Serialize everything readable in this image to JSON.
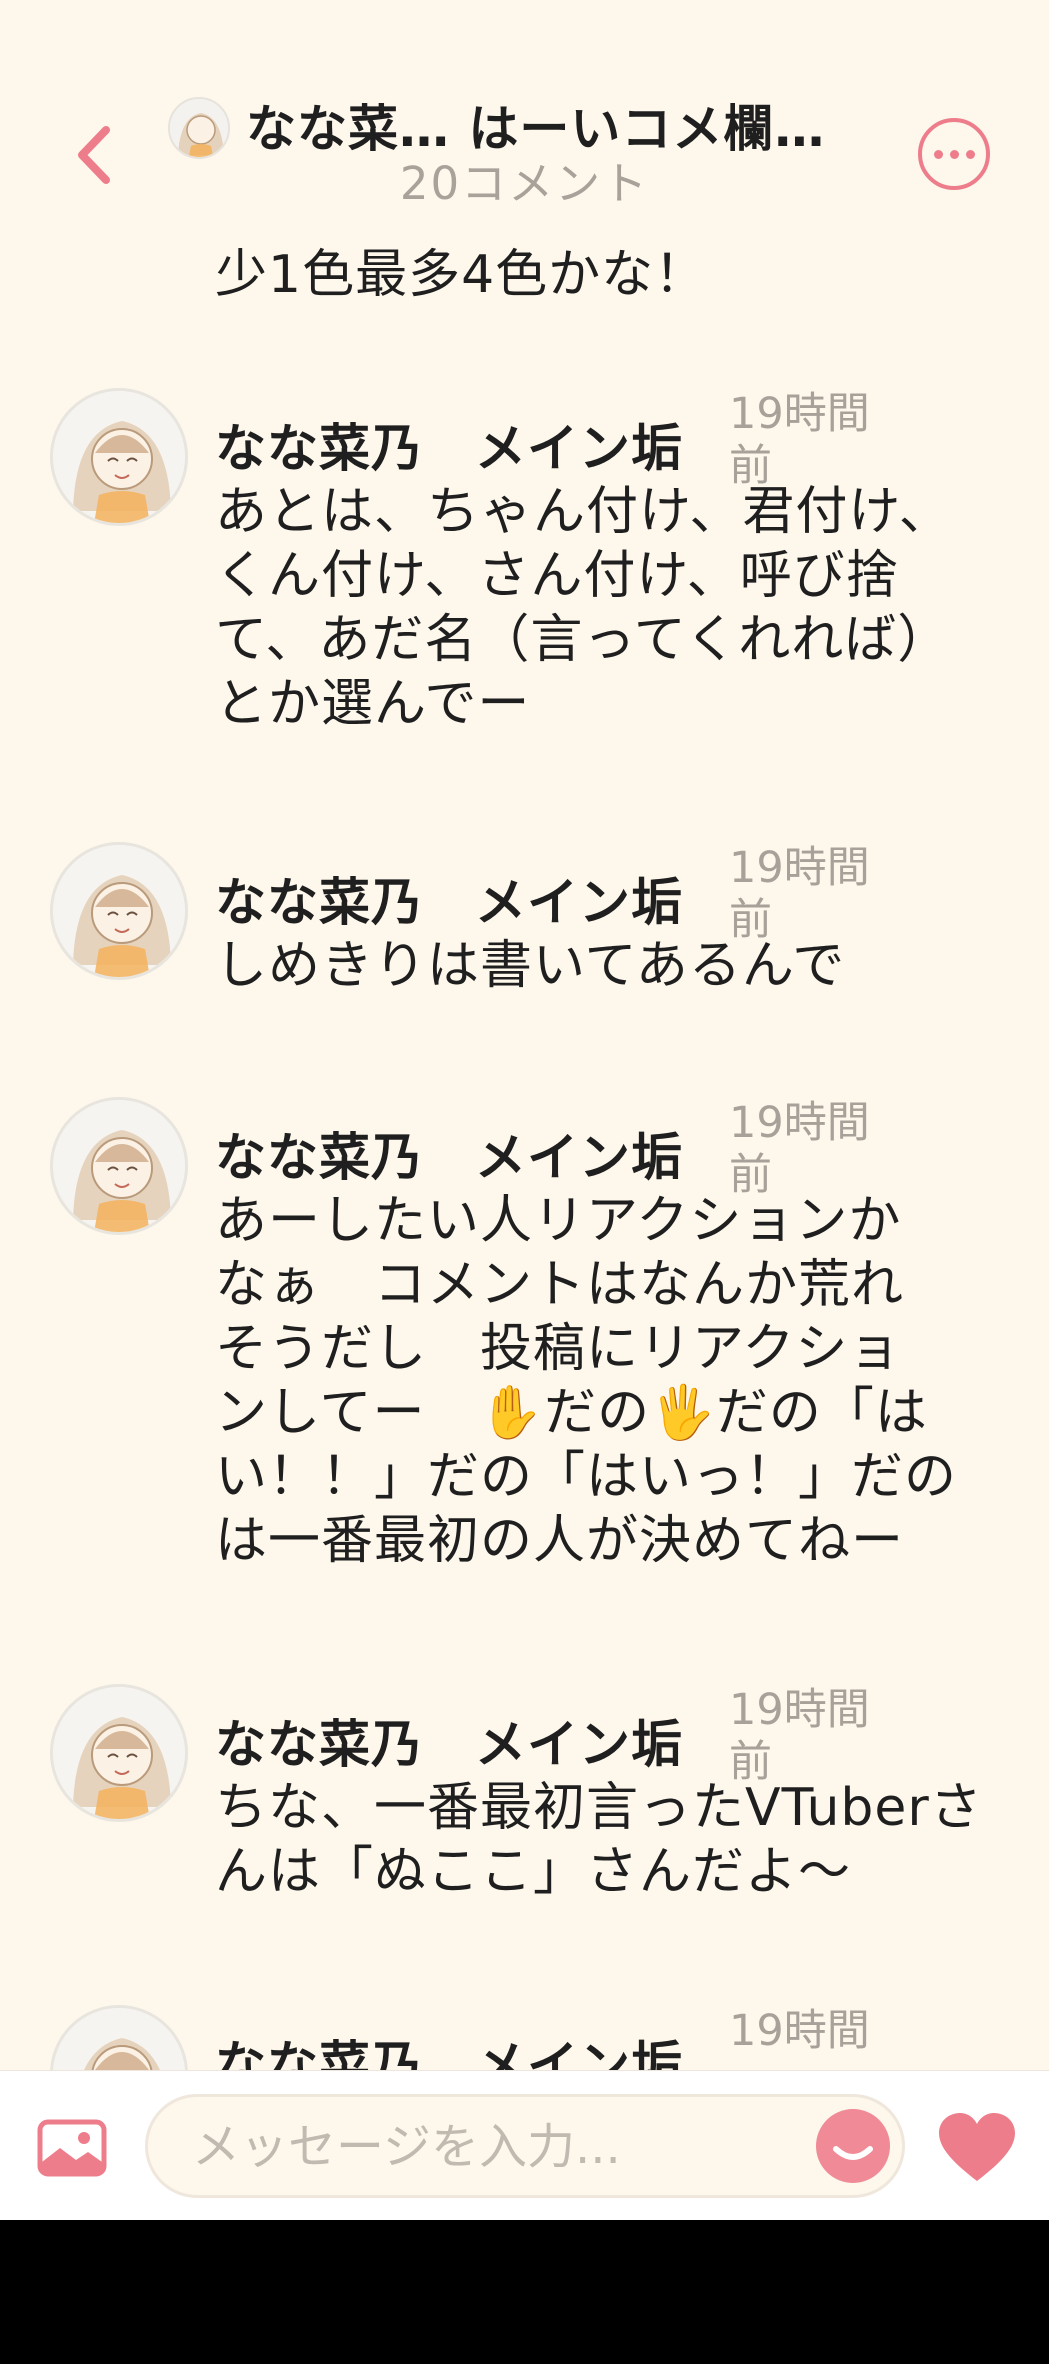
{
  "header": {
    "title": "なな菜… はーいコメ欄…",
    "comment_count": "20コメント",
    "back_icon": "chevron-left-icon",
    "more_icon": "more-horizontal-icon"
  },
  "feed": {
    "previous_line": "少1色最多4色かな！",
    "comments": [
      {
        "author": "なな菜乃　メイン垢",
        "time_lines": [
          "19時間",
          "前"
        ],
        "text_lines": [
          "あとは、ちゃん付け、君付け、",
          "くん付け、さん付け、呼び捨",
          "て、あだ名（言ってくれれば）",
          "とか選んでー"
        ]
      },
      {
        "author": "なな菜乃　メイン垢",
        "time_lines": [
          "19時間",
          "前"
        ],
        "text_lines": [
          "しめきりは書いてあるんで"
        ]
      },
      {
        "author": "なな菜乃　メイン垢",
        "time_lines": [
          "19時間",
          "前"
        ],
        "text_lines": [
          "あーしたい人リアクションか",
          "なぁ　コメントはなんか荒れ",
          "そうだし　投稿にリアクショ",
          "ンしてー　✋だの🖐️だの「は",
          "い！！」だの「はいっ！」だの",
          "は一番最初の人が決めてねー"
        ]
      },
      {
        "author": "なな菜乃　メイン垢",
        "time_lines": [
          "19時間",
          "前"
        ],
        "text_lines": [
          "ちな、一番最初言ったVTuberさ",
          "んは「ぬここ」さんだよ〜"
        ]
      },
      {
        "author": "なな菜乃　メイン垢",
        "time_lines": [
          "19時間",
          ""
        ],
        "text_lines": []
      }
    ]
  },
  "composer": {
    "placeholder": "メッセージを入力...",
    "image_icon": "image-icon",
    "emoji_icon": "emoji-smile-icon",
    "heart_icon": "heart-icon"
  },
  "colors": {
    "background": "#fdf7ec",
    "accent": "#ee7d8b",
    "muted_text": "#a7a199"
  }
}
